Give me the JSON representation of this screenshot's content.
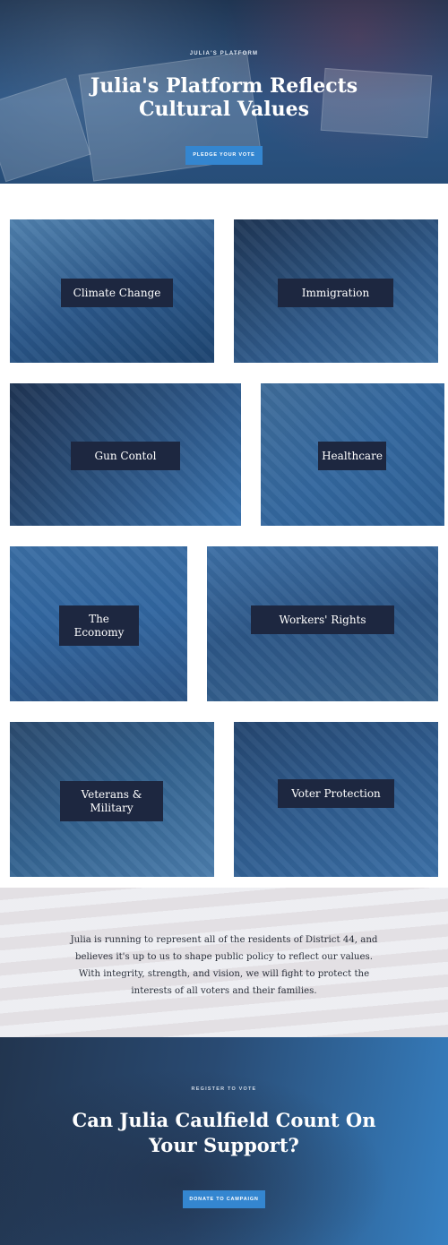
{
  "hero": {
    "eyebrow": "JULIA'S PLATFORM",
    "title": "Julia's Platform Reflects Cultural Values",
    "button_label": "PLEDGE YOUR VOTE"
  },
  "issues": [
    {
      "name": "issue-climate-change",
      "label": "Climate Change"
    },
    {
      "name": "issue-immigration",
      "label": "Immigration"
    },
    {
      "name": "issue-gun-control",
      "label": "Gun Contol"
    },
    {
      "name": "issue-healthcare",
      "label": "Healthcare"
    },
    {
      "name": "issue-economy",
      "label": "The Economy"
    },
    {
      "name": "issue-workers-rights",
      "label": "Workers' Rights"
    },
    {
      "name": "issue-veterans-military",
      "label": "Veterans & Military"
    },
    {
      "name": "issue-voter-protection",
      "label": "Voter Protection"
    }
  ],
  "statement": {
    "text": "Julia is running to represent all of the residents of District 44, and believes it's up to us to shape public policy to reflect our values. With integrity, strength, and vision, we will fight to protect the interests of all voters and their families."
  },
  "cta": {
    "eyebrow": "REGISTER TO VOTE",
    "title": "Can Julia Caulfield Count On Your Support?",
    "button_label": "DONATE TO CAMPAIGN"
  },
  "colors": {
    "accent": "#3486d0",
    "label_bg": "#1d2740",
    "hero_bg": "#274d78"
  }
}
